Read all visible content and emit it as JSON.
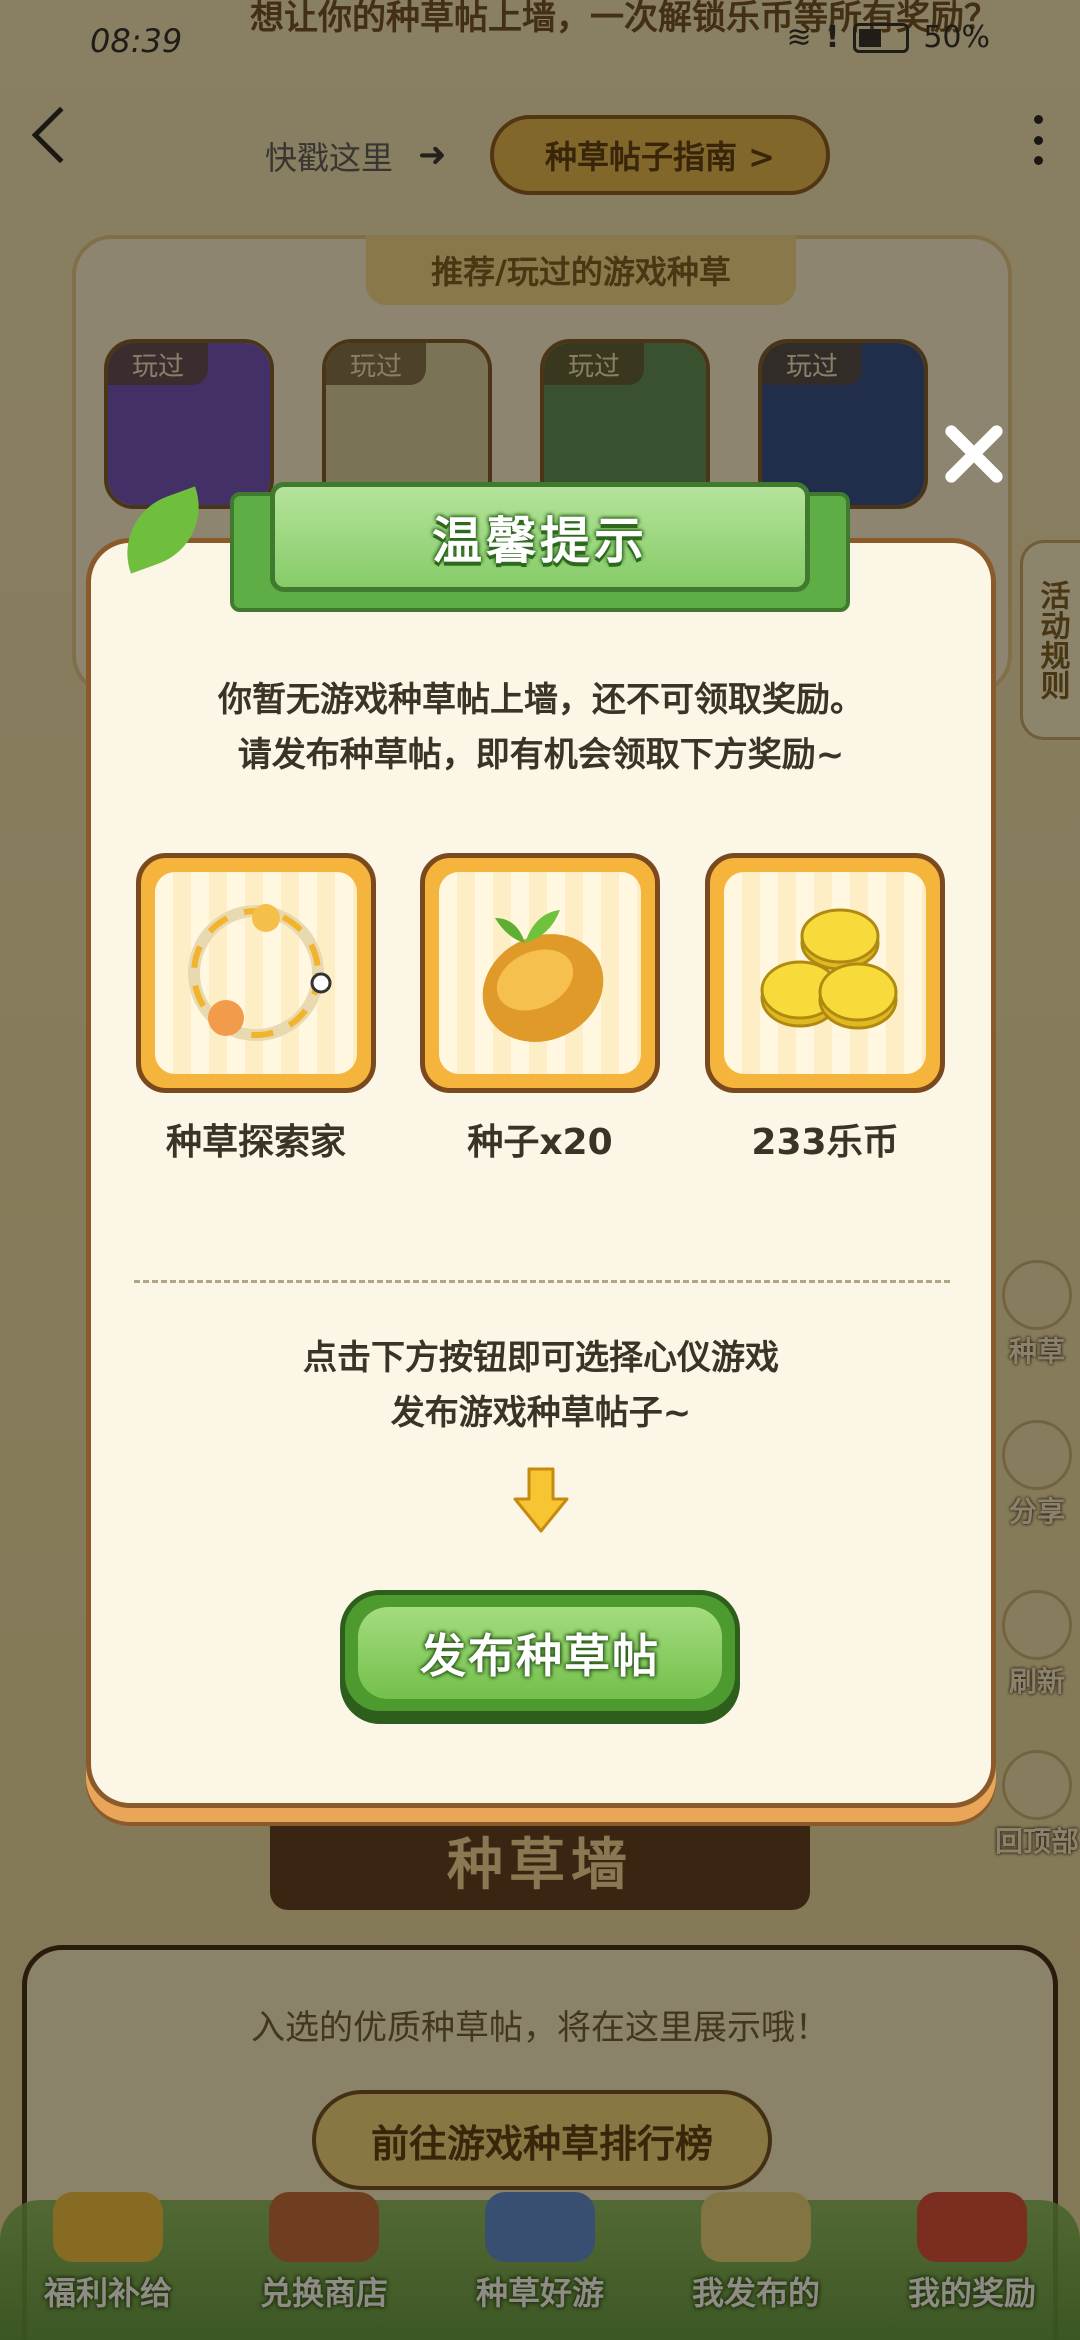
{
  "status": {
    "time": "08:39",
    "battery": "50%"
  },
  "top_banner": "想让你的种草帖上墙，一次解锁乐币等所有奖励？",
  "nav": {
    "hint": "快戳这里",
    "guide_button": "种草帖子指南 >"
  },
  "game_section": {
    "title": "推荐/玩过的游戏种草",
    "games": [
      {
        "tag": "玩过",
        "color": "#6b4fc2"
      },
      {
        "tag": "玩过",
        "color": "#d9cfa0"
      },
      {
        "tag": "玩过",
        "color": "#5b8f55"
      },
      {
        "tag": "玩过",
        "color": "#2b4c8f"
      }
    ]
  },
  "side_rule": "活动规则",
  "side_buttons": [
    {
      "label": "种草"
    },
    {
      "label": "分享"
    },
    {
      "label": "刷新"
    },
    {
      "label": "回顶部"
    }
  ],
  "wall": {
    "sign": "种草墙",
    "text": "入选的优质种草帖，将在这里展示哦！",
    "rank_button": "前往游戏种草排行榜"
  },
  "bottom_nav": [
    {
      "label": "福利补给",
      "color": "#f0c040"
    },
    {
      "label": "兑换商店",
      "color": "#c26a3a"
    },
    {
      "label": "种草好游",
      "color": "#5a8ad6"
    },
    {
      "label": "我发布的",
      "color": "#e7d37a"
    },
    {
      "label": "我的奖励",
      "color": "#d84a3a"
    }
  ],
  "modal": {
    "title": "温馨提示",
    "line1": "你暂无游戏种草帖上墙，还不可领取奖励。",
    "line2": "请发布种草帖，即有机会领取下方奖励~",
    "rewards": [
      {
        "name": "种草探索家",
        "icon": "avatar-frame-icon"
      },
      {
        "name": "种子x20",
        "icon": "seed-icon"
      },
      {
        "name": "233乐币",
        "icon": "coins-icon"
      }
    ],
    "line3": "点击下方按钮即可选择心仪游戏",
    "line4": "发布游戏种草帖子~",
    "cta": "发布种草帖"
  }
}
